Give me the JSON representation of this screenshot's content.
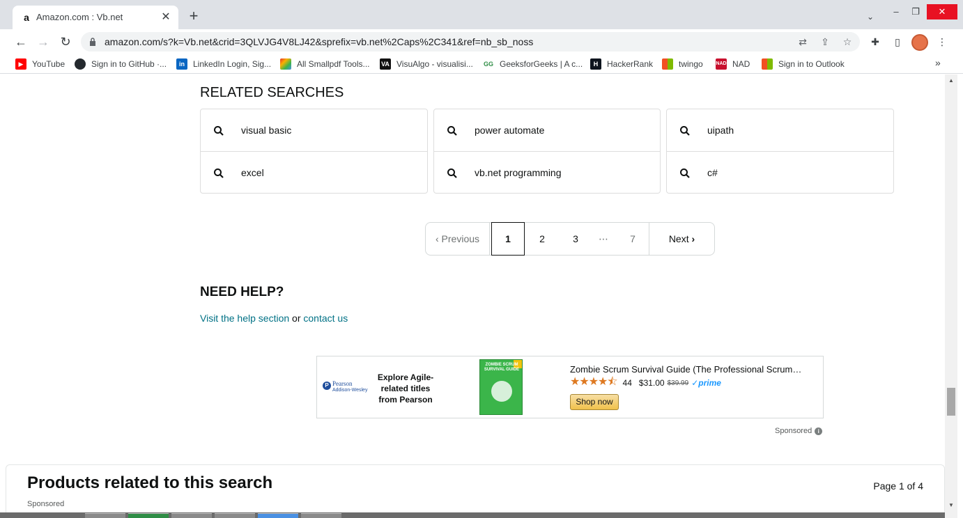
{
  "browser": {
    "tab": {
      "title": "Amazon.com : Vb.net",
      "favicon": "a"
    },
    "url": "amazon.com/s?k=Vb.net&crid=3QLVJG4V8LJ42&sprefix=vb.net%2Caps%2C341&ref=nb_sb_noss",
    "bookmarks": [
      {
        "label": "YouTube",
        "icon": "youtube-icon",
        "color": "#ff0000"
      },
      {
        "label": "Sign in to GitHub ·...",
        "icon": "github-icon",
        "color": "#24292e"
      },
      {
        "label": "LinkedIn Login, Sig...",
        "icon": "linkedin-icon",
        "color": "#0a66c2"
      },
      {
        "label": "All Smallpdf Tools...",
        "icon": "smallpdf-icon",
        "color": "#e5322d"
      },
      {
        "label": "VisuAlgo - visualisi...",
        "icon": "visualgo-icon",
        "color": "#111111"
      },
      {
        "label": "GeeksforGeeks | A c...",
        "icon": "geeksforgeeks-icon",
        "color": "#2f8d46"
      },
      {
        "label": "HackerRank",
        "icon": "hackerrank-icon",
        "color": "#0e141e"
      },
      {
        "label": "twingo",
        "icon": "twingo-icon",
        "color": "#f25022"
      },
      {
        "label": "NAD",
        "icon": "nad-icon",
        "color": "#c8102e"
      },
      {
        "label": "Sign in to Outlook",
        "icon": "microsoft-icon",
        "color": "#00a4ef"
      }
    ],
    "more": "»"
  },
  "related": {
    "title": "RELATED SEARCHES",
    "items": [
      "visual basic",
      "power automate",
      "uipath",
      "excel",
      "vb.net programming",
      "c#"
    ]
  },
  "pagination": {
    "previous": "Previous",
    "current": "1",
    "pages": [
      "2",
      "3"
    ],
    "ellipsis": "⋯",
    "last": "7",
    "next": "Next"
  },
  "help": {
    "title": "NEED HELP?",
    "link1": "Visit the help section",
    "or": "or",
    "link2": "contact us"
  },
  "ad": {
    "brand": "Pearson",
    "brand_sub": "Addison-Wesley",
    "tagline": "Explore Agile-related titles from Pearson",
    "book_cover": "ZOMBIE SCRUM SURVIVAL GUIDE",
    "product": "Zombie Scrum Survival Guide (The Professional Scrum…",
    "rating": 4.5,
    "rating_count": "44",
    "price": "$31.00",
    "old_price": "$39.99",
    "prime": "prime",
    "cta": "Shop now",
    "sponsored": "Sponsored"
  },
  "products_related": {
    "title": "Products related to this search",
    "page": "Page 1 of 4",
    "sponsored": "Sponsored"
  }
}
